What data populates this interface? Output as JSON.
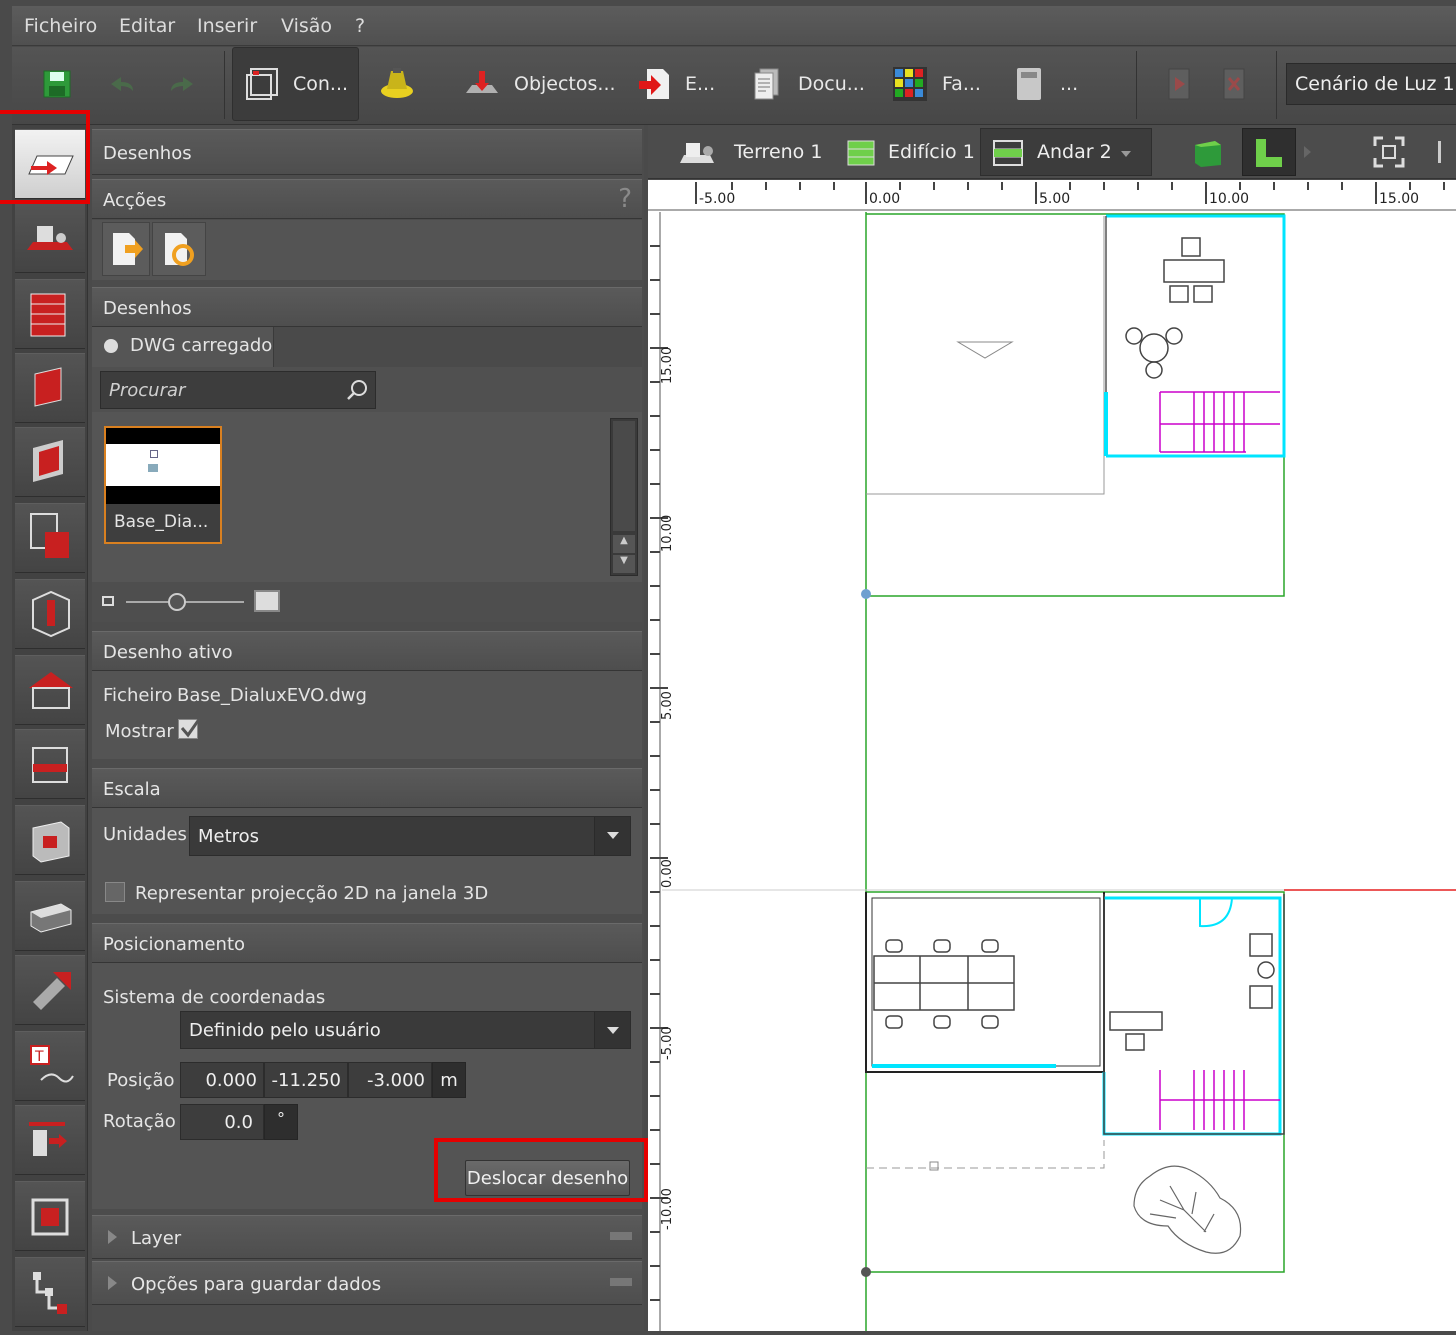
{
  "menu": [
    "Ficheiro",
    "Editar",
    "Inserir",
    "Visão",
    "?"
  ],
  "toolbar": {
    "items": [
      "Con...",
      "Objectos...",
      "E...",
      "Docu...",
      "Fa...",
      "..."
    ],
    "scene": "Cenário de Luz 1"
  },
  "panel": {
    "title": "Desenhos",
    "actions_header": "Acções",
    "help_glyph": "?",
    "drawings_header": "Desenhos",
    "dwg_tab": "DWG carregado",
    "search_placeholder": "Procurar",
    "thumbnail_label": "Base_Dia...",
    "active_header": "Desenho ativo",
    "file_label": "Ficheiro",
    "file_name": "Base_DialuxEVO.dwg",
    "show_label": "Mostrar",
    "scale_header": "Escala",
    "units_label": "Unidades",
    "units_value": "Metros",
    "projection_label": "Representar projecção 2D na janela 3D",
    "positioning_header": "Posicionamento",
    "coord_label": "Sistema de coordenadas",
    "coord_value": "Definido pelo usuário",
    "position_label": "Posição",
    "pos_x": "0.000",
    "pos_y": "-11.250",
    "pos_z": "-3.000",
    "pos_unit": "m",
    "rotation_label": "Rotação",
    "rotation_value": "0.0",
    "rotation_unit": "°",
    "move_button": "Deslocar desenho",
    "layer_header": "Layer",
    "save_options_header": "Opções para guardar dados"
  },
  "viewport": {
    "tabs": [
      "Terreno 1",
      "Edifício 1",
      "Andar 2"
    ],
    "ruler_x": [
      "-5.00",
      "0.00",
      "5.00",
      "10.00",
      "15.00"
    ],
    "ruler_y": [
      "15.00",
      "10.00",
      "5.00",
      "0.00",
      "-5.00",
      "-10.00"
    ]
  },
  "colors": {
    "highlight": "#e60000",
    "wall_cyan": "#00e5ff",
    "stairs_magenta": "#cc00cc",
    "site_green": "#2aa52a"
  },
  "icons": [
    "save-icon",
    "undo-icon",
    "redo-icon",
    "construction-icon",
    "light-icon",
    "objects-icon",
    "export-icon",
    "documentation-icon",
    "facade-icon",
    "calculator-icon",
    "play-icon",
    "stop-icon"
  ]
}
